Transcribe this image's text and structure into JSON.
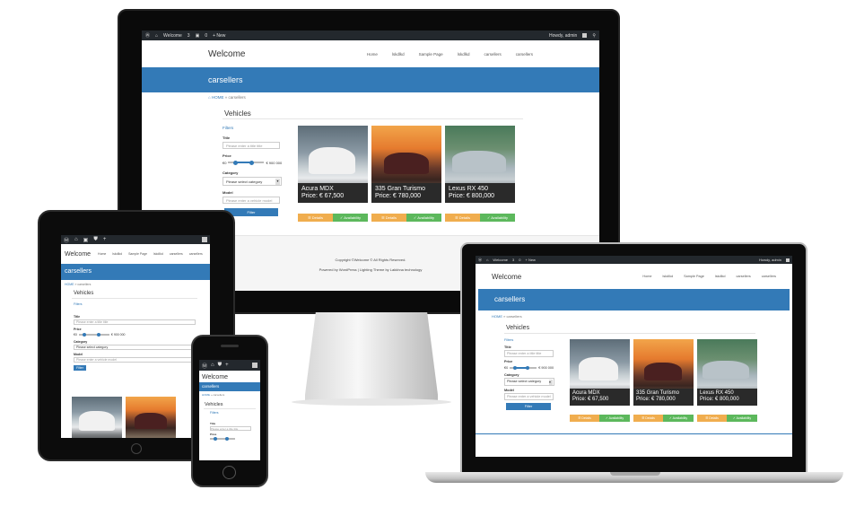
{
  "wpbar": {
    "welcome": "Welcome",
    "comments": "0",
    "updates": "3",
    "new": "+ New",
    "user": "Howdy, admin"
  },
  "site": {
    "title": "Welcome",
    "nav": [
      "Home",
      "lskdlkd",
      "Sample Page",
      "lskdlkd",
      "carsellers",
      "carsellers"
    ],
    "band_title": "carsellers",
    "breadcrumb_home": "HOME",
    "breadcrumb_sep": "»",
    "breadcrumb_current": "carsellers"
  },
  "vehicles": {
    "heading": "Vehicles",
    "filters_label": "Filters",
    "title_label": "Title",
    "title_placeholder": "Please enter a title title",
    "price_label": "Price",
    "price_min": "€0",
    "price_max": "€ 900 000",
    "category_label": "Category",
    "category_value": "Please select category",
    "model_label": "Model",
    "model_placeholder": "Please enter a vehicle model",
    "filter_button": "Filter"
  },
  "cars": [
    {
      "name": "Acura MDX",
      "price": "Price: € 67,500",
      "photo": "white-suv"
    },
    {
      "name": "335 Gran Turismo",
      "price": "Price: € 780,000",
      "photo": "sunset-suv"
    },
    {
      "name": "Lexus RX 450",
      "price": "Price: € 800,000",
      "photo": "grey-suv"
    }
  ],
  "car_buttons": {
    "details": "Details",
    "availability": "Availability"
  },
  "footer": {
    "copyright": "Copyright ©Welcome © All Rights Reserved.",
    "powered": "Powered by WordPress | Lighting Theme by Lakkhna technology"
  },
  "colors": {
    "brand": "#337ab7",
    "details": "#f0ad4e",
    "availability": "#5cb85c",
    "wpbar": "#23282d"
  }
}
